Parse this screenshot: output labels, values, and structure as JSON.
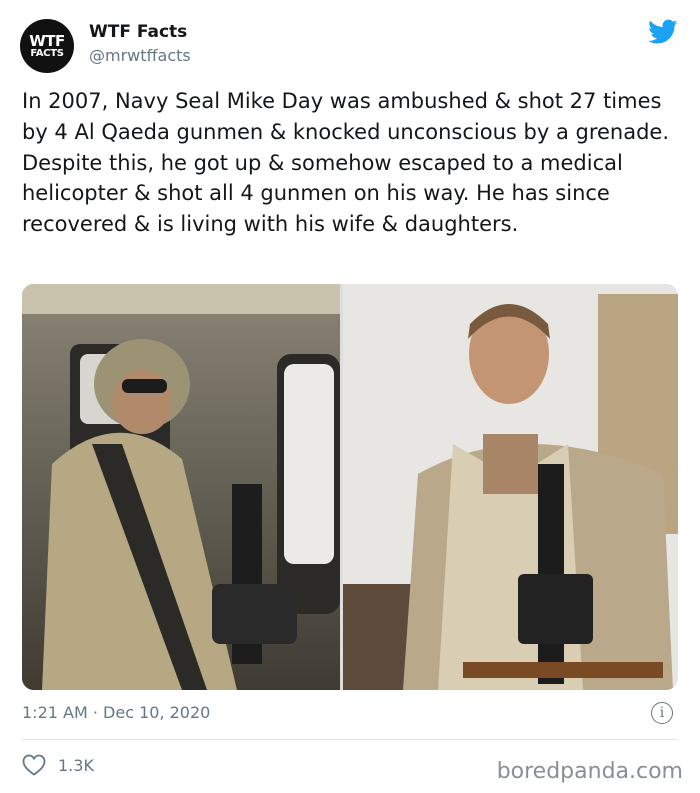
{
  "account": {
    "avatar_line1": "WTF",
    "avatar_line2": "FACTS",
    "display_name": "WTF Facts",
    "handle": "@mrwtffacts"
  },
  "tweet": {
    "text": "In 2007, Navy Seal Mike Day was ambushed & shot 27 times by 4 Al Qaeda gunmen & knocked unconscious by a grenade. Despite this, he got up & somehow escaped to a medical helicopter & shot all 4 gunmen on his way. He has since recovered & is living with his wife & daughters.",
    "timestamp": "1:21 AM · Dec 10, 2020",
    "likes": "1.3K"
  },
  "icons": {
    "brand": "twitter-bird-icon",
    "info": "info-icon",
    "like": "heart-icon"
  },
  "colors": {
    "twitter_blue": "#1da1f2",
    "meta_gray": "#657786",
    "text": "#14171a"
  },
  "watermark": "boredpanda.com"
}
